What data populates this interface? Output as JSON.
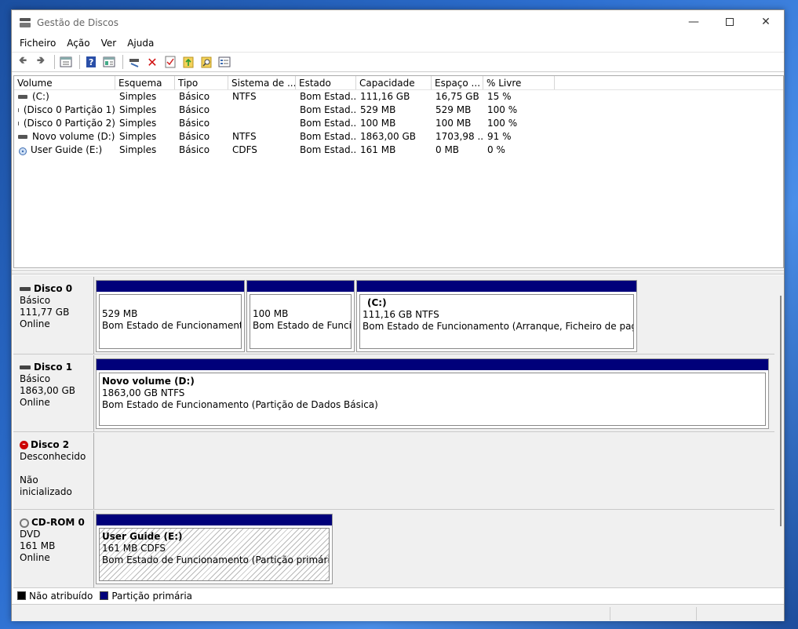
{
  "window": {
    "title": "Gestão de Discos"
  },
  "menu": [
    "Ficheiro",
    "Ação",
    "Ver",
    "Ajuda"
  ],
  "toolbar_icons": [
    "back-icon",
    "forward-icon",
    "properties-icon",
    "help-icon",
    "view-icon",
    "connect-icon",
    "delete-icon",
    "check-icon",
    "explore-icon",
    "find-icon",
    "settings-icon"
  ],
  "volume_list": {
    "headers": [
      "Volume",
      "Esquema",
      "Tipo",
      "Sistema de ...",
      "Estado",
      "Capacidade",
      "Espaço ...",
      "% Livre"
    ],
    "rows": [
      {
        "volume": "(C:)",
        "esquema": "Simples",
        "tipo": "Básico",
        "sistema": "NTFS",
        "estado": "Bom Estad...",
        "capacidade": "111,16 GB",
        "espaco": "16,75 GB",
        "livre": "15 %"
      },
      {
        "volume": "(Disco 0 Partição 1)",
        "esquema": "Simples",
        "tipo": "Básico",
        "sistema": "",
        "estado": "Bom Estad...",
        "capacidade": "529 MB",
        "espaco": "529 MB",
        "livre": "100 %"
      },
      {
        "volume": "(Disco 0 Partição 2)",
        "esquema": "Simples",
        "tipo": "Básico",
        "sistema": "",
        "estado": "Bom Estad...",
        "capacidade": "100 MB",
        "espaco": "100 MB",
        "livre": "100 %"
      },
      {
        "volume": "Novo volume (D:)",
        "esquema": "Simples",
        "tipo": "Básico",
        "sistema": "NTFS",
        "estado": "Bom Estad...",
        "capacidade": "1863,00 GB",
        "espaco": "1703,98 ...",
        "livre": "91 %"
      },
      {
        "volume": "User Guide (E:)",
        "esquema": "Simples",
        "tipo": "Básico",
        "sistema": "CDFS",
        "estado": "Bom Estad...",
        "capacidade": "161 MB",
        "espaco": "0 MB",
        "livre": "0 %"
      }
    ]
  },
  "disks": [
    {
      "name": "Disco 0",
      "type": "Básico",
      "size": "111,77 GB",
      "status": "Online",
      "partitions": [
        {
          "name": "",
          "size": "529 MB",
          "state": "Bom Estado de Funcionamento (Partição de Recuperação)"
        },
        {
          "name": "",
          "size": "100 MB",
          "state": "Bom Estado de Funcionamento (Partição de Sistema EFI)"
        },
        {
          "name": "(C:)",
          "size": "111,16 GB NTFS",
          "state": "Bom Estado de Funcionamento (Arranque, Ficheiro de paginação"
        }
      ]
    },
    {
      "name": "Disco 1",
      "type": "Básico",
      "size": "1863,00 GB",
      "status": "Online",
      "partitions": [
        {
          "name": "Novo volume  (D:)",
          "size": "1863,00 GB NTFS",
          "state": "Bom Estado de Funcionamento (Partição de Dados Básica)"
        }
      ]
    },
    {
      "name": "Disco 2",
      "type": "Desconhecido",
      "size": "",
      "status": "Não inicializado",
      "partitions": []
    },
    {
      "name": "CD-ROM 0",
      "type": "DVD",
      "size": "161 MB",
      "status": "Online",
      "partitions": [
        {
          "name": "User Guide  (E:)",
          "size": "161 MB CDFS",
          "state": "Bom Estado de Funcionamento (Partição primária)"
        }
      ]
    }
  ],
  "legend": [
    {
      "label": "Não atribuído",
      "color": "#000000"
    },
    {
      "label": "Partição primária",
      "color": "#00007a"
    }
  ]
}
